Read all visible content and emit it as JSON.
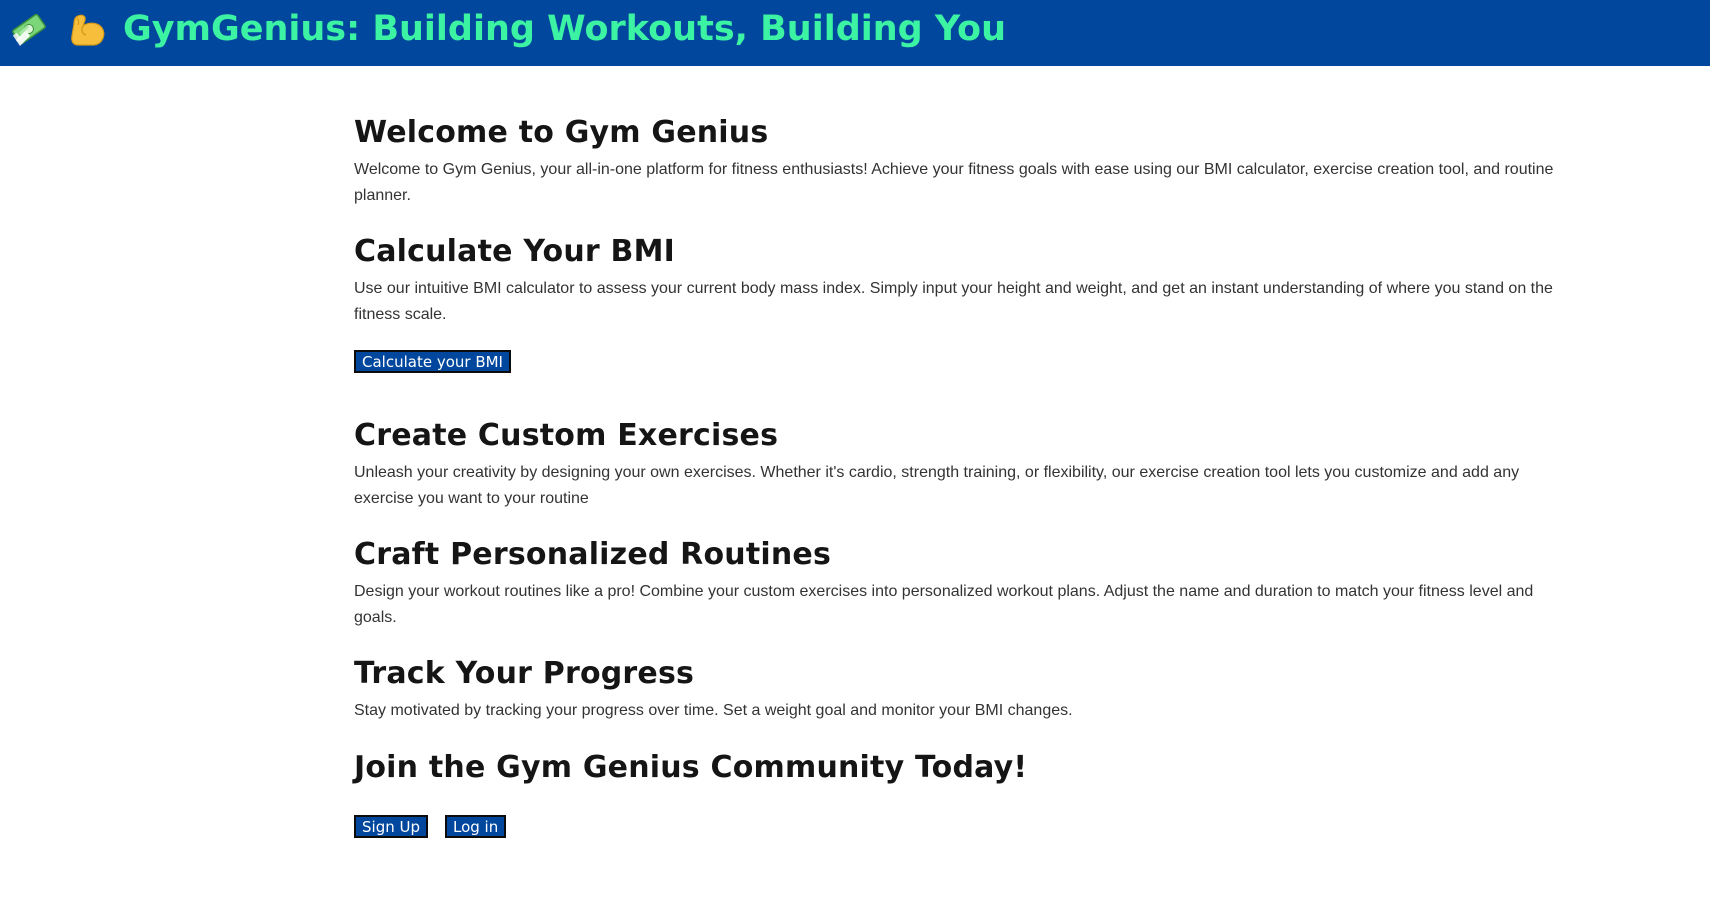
{
  "header": {
    "title": "GymGenius: Building Workouts, Building You",
    "icons": [
      "money-icon",
      "flexed-biceps-icon"
    ],
    "background_color": "#01479e",
    "title_color": "#3cf2a3"
  },
  "sections": {
    "welcome": {
      "heading": "Welcome to Gym Genius",
      "text": "Welcome to Gym Genius, your all-in-one platform for fitness enthusiasts! Achieve your fitness goals with ease using our BMI calculator, exercise creation tool, and routine planner."
    },
    "bmi": {
      "heading": "Calculate Your BMI",
      "text": "Use our intuitive BMI calculator to assess your current body mass index. Simply input your height and weight, and get an instant understanding of where you stand on the fitness scale.",
      "button_label": "Calculate your BMI"
    },
    "exercises": {
      "heading": "Create Custom Exercises",
      "text": "Unleash your creativity by designing your own exercises. Whether it's cardio, strength training, or flexibility, our exercise creation tool lets you customize and add any exercise you want to your routine"
    },
    "routines": {
      "heading": "Craft Personalized Routines",
      "text": "Design your workout routines like a pro! Combine your custom exercises into personalized workout plans. Adjust the name and duration to match your fitness level and goals."
    },
    "progress": {
      "heading": "Track Your Progress",
      "text": "Stay motivated by tracking your progress over time. Set a weight goal and monitor your BMI changes."
    },
    "join": {
      "heading": "Join the Gym Genius Community Today!",
      "signup_label": "Sign Up",
      "login_label": "Log in"
    }
  },
  "colors": {
    "button_background": "#01479e",
    "button_text": "#ffffff"
  }
}
